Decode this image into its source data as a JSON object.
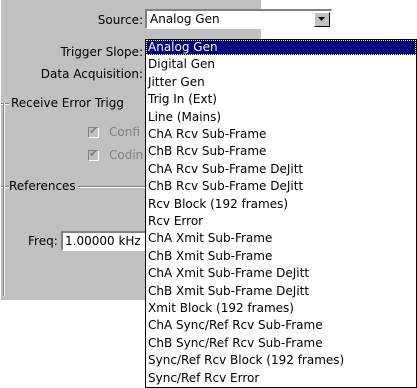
{
  "form": {
    "source_label": "Source:",
    "trigger_slope_label": "Trigger Slope:",
    "data_acquisition_label": "Data Acquisition:",
    "receive_error_group": "Receive Error Trigg",
    "checkbox1_label": "Confi",
    "checkbox2_label": "Codin",
    "references_group": "References",
    "freq_label": "Freq:",
    "freq_value": "1.00000 kHz"
  },
  "source_select": {
    "selected": "Analog Gen",
    "options": [
      "Analog Gen",
      "Digital Gen",
      "Jitter Gen",
      "Trig In (Ext)",
      "Line (Mains)",
      "ChA Rcv Sub-Frame",
      "ChB Rcv Sub-Frame",
      "ChA Rcv Sub-Frame DeJitt",
      "ChB Rcv Sub-Frame DeJitt",
      "Rcv Block (192 frames)",
      "Rcv Error",
      "ChA Xmit Sub-Frame",
      "ChB Xmit Sub-Frame",
      "ChA Xmit Sub-Frame DeJitt",
      "ChB Xmit Sub-Frame DeJitt",
      "Xmit Block (192 frames)",
      "ChA Sync/Ref Rcv Sub-Frame",
      "ChB Sync/Ref Rcv Sub-Frame",
      "Sync/Ref Rcv Block (192 frames)",
      "Sync/Ref Rcv Error"
    ]
  },
  "colors": {
    "panel": "#c0c0c0",
    "highlight": "#000080",
    "disabled_text": "#808080"
  },
  "icons": {
    "dropdown_button": "chevron-down-icon",
    "checkbox_mark": "checkmark-icon"
  }
}
